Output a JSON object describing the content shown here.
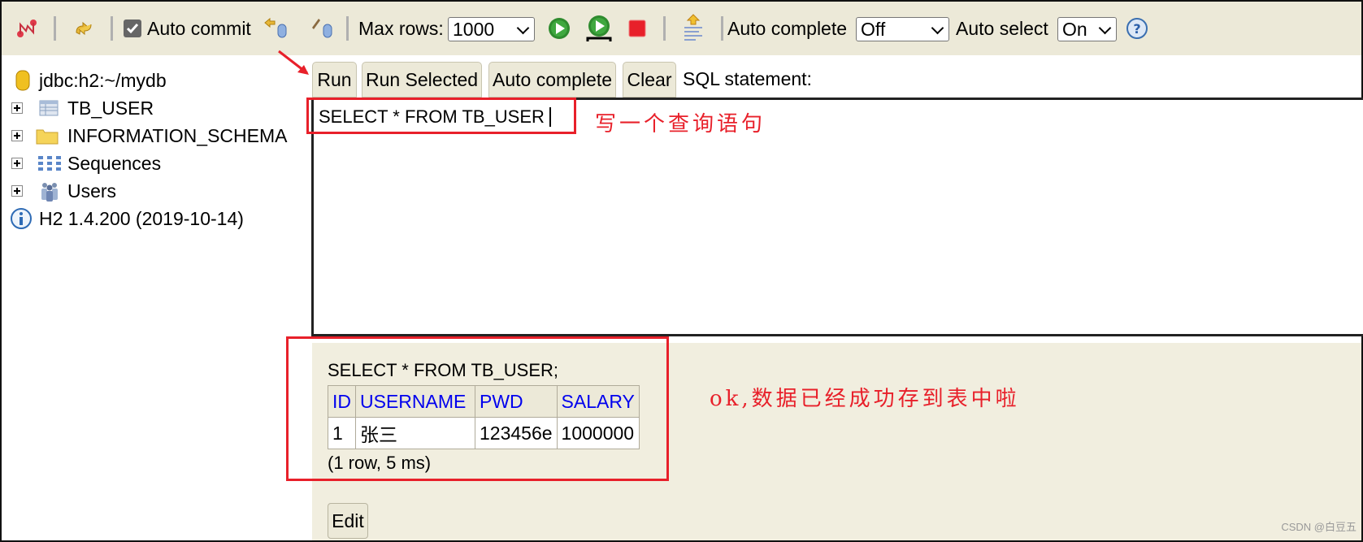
{
  "toolbar": {
    "icons": [
      "disconnect-icon",
      "refresh-icon",
      "rollback-icon",
      "commit-icon",
      "run-icon",
      "run-selected-icon",
      "stop-icon",
      "history-icon",
      "help-icon"
    ],
    "auto_commit_label": "Auto commit",
    "auto_commit_checked": true,
    "max_rows_label": "Max rows:",
    "max_rows_value": "1000",
    "auto_complete_label": "Auto complete",
    "auto_complete_value": "Off",
    "auto_select_label": "Auto select",
    "auto_select_value": "On"
  },
  "sidebar": {
    "connection": "jdbc:h2:~/mydb",
    "items": [
      {
        "label": "TB_USER",
        "icon": "table-icon"
      },
      {
        "label": "INFORMATION_SCHEMA",
        "icon": "folder-icon"
      },
      {
        "label": "Sequences",
        "icon": "sequences-icon"
      },
      {
        "label": "Users",
        "icon": "users-icon"
      }
    ],
    "version": "H2 1.4.200 (2019-10-14)"
  },
  "sql_buttons": {
    "run": "Run",
    "run_selected": "Run Selected",
    "auto_complete": "Auto complete",
    "clear": "Clear",
    "statement_label": "SQL statement:"
  },
  "editor": {
    "value": "SELECT * FROM TB_USER"
  },
  "results": {
    "query": "SELECT * FROM TB_USER;",
    "columns": [
      "ID",
      "USERNAME",
      "PWD",
      "SALARY"
    ],
    "rows": [
      [
        "1",
        "张三",
        "123456e",
        "1000000"
      ]
    ],
    "summary": "(1 row, 5 ms)",
    "edit_label": "Edit"
  },
  "annotations": {
    "query_note": "写一个查询语句",
    "result_note": "ok,数据已经成功存到表中啦",
    "color": "#e8202a"
  },
  "watermark": "CSDN @白豆五"
}
